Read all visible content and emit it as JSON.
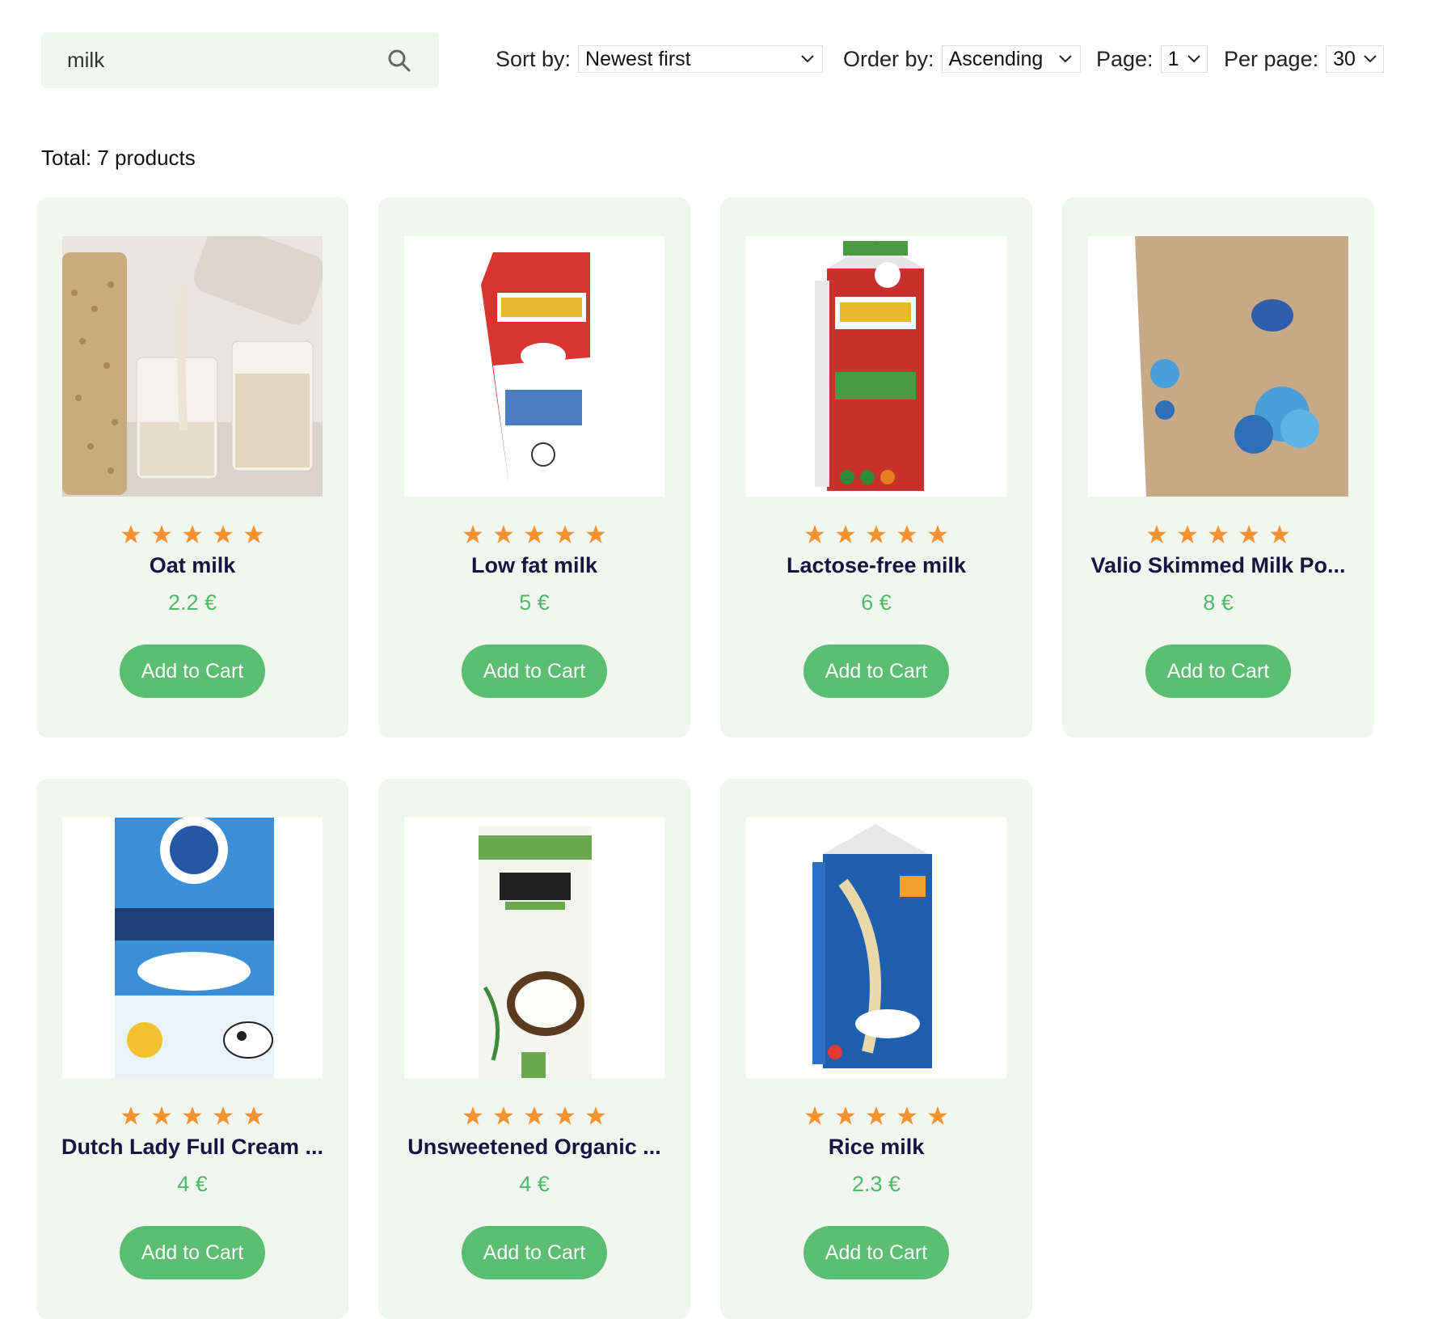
{
  "search": {
    "value": "milk",
    "placeholder": "Search"
  },
  "controls": {
    "sort_label": "Sort by:",
    "sort_value": "Newest first",
    "order_label": "Order by:",
    "order_value": "Ascending",
    "page_label": "Page:",
    "page_value": "1",
    "per_page_label": "Per page:",
    "per_page_value": "30"
  },
  "total_text": "Total: 7 products",
  "colors": {
    "card_bg": "#f1f6ef",
    "accent": "#5bbd72",
    "price": "#4fb86a",
    "star": "#f5922f",
    "title": "#141640"
  },
  "products": [
    {
      "name": "Oat milk",
      "price": "2.2 €",
      "rating": 5,
      "button": "Add to Cart",
      "image": "oat-milk-jars-image"
    },
    {
      "name": "Low fat milk",
      "price": "5 €",
      "rating": 5,
      "button": "Add to Cart",
      "image": "horizon-lowfat-carton-image"
    },
    {
      "name": "Lactose-free milk",
      "price": "6 €",
      "rating": 5,
      "button": "Add to Cart",
      "image": "horizon-lactose-free-carton-image"
    },
    {
      "name": "Valio Skimmed Milk Po...",
      "price": "8 €",
      "rating": 5,
      "button": "Add to Cart",
      "image": "valio-powder-bag-image"
    },
    {
      "name": "Dutch Lady Full Cream ...",
      "price": "4 €",
      "rating": 5,
      "button": "Add to Cart",
      "image": "dutch-lady-carton-image"
    },
    {
      "name": "Unsweetened Organic ...",
      "price": "4 €",
      "rating": 5,
      "button": "Add to Cart",
      "image": "so-delicious-coconut-carton-image"
    },
    {
      "name": "Rice milk",
      "price": "2.3 €",
      "rating": 5,
      "button": "Add to Cart",
      "image": "rice-dream-carton-image"
    }
  ]
}
